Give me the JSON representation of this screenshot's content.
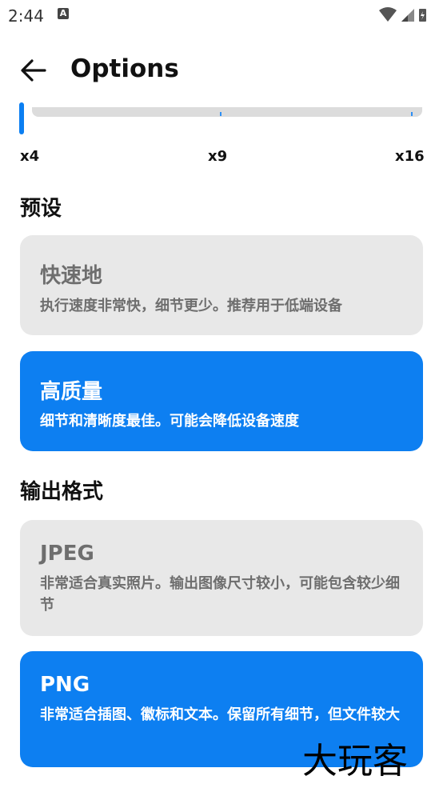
{
  "status_bar": {
    "time": "2:44",
    "notification_glyph": "A"
  },
  "app_bar": {
    "title": "Options"
  },
  "scale": {
    "labels": [
      "x4",
      "x9",
      "x16"
    ]
  },
  "presets": {
    "heading": "预设",
    "fast": {
      "title": "快速地",
      "description": "执行速度非常快，细节更少。推荐用于低端设备",
      "selected": false
    },
    "quality": {
      "title": "高质量",
      "description": "细节和清晰度最佳。可能会降低设备速度",
      "selected": true
    }
  },
  "output_format": {
    "heading": "输出格式",
    "jpeg": {
      "title": "JPEG",
      "description": "非常适合真实照片。输出图像尺寸较小，可能包含较少细节",
      "selected": false
    },
    "png": {
      "title": "PNG",
      "description": "非常适合插图、徽标和文本。保留所有细节，但文件较大",
      "selected": true
    }
  },
  "watermark": "大玩客",
  "colors": {
    "accent": "#0d7ff1",
    "card_inactive": "#e8e8e8",
    "text_inactive": "#6e6e6e"
  }
}
